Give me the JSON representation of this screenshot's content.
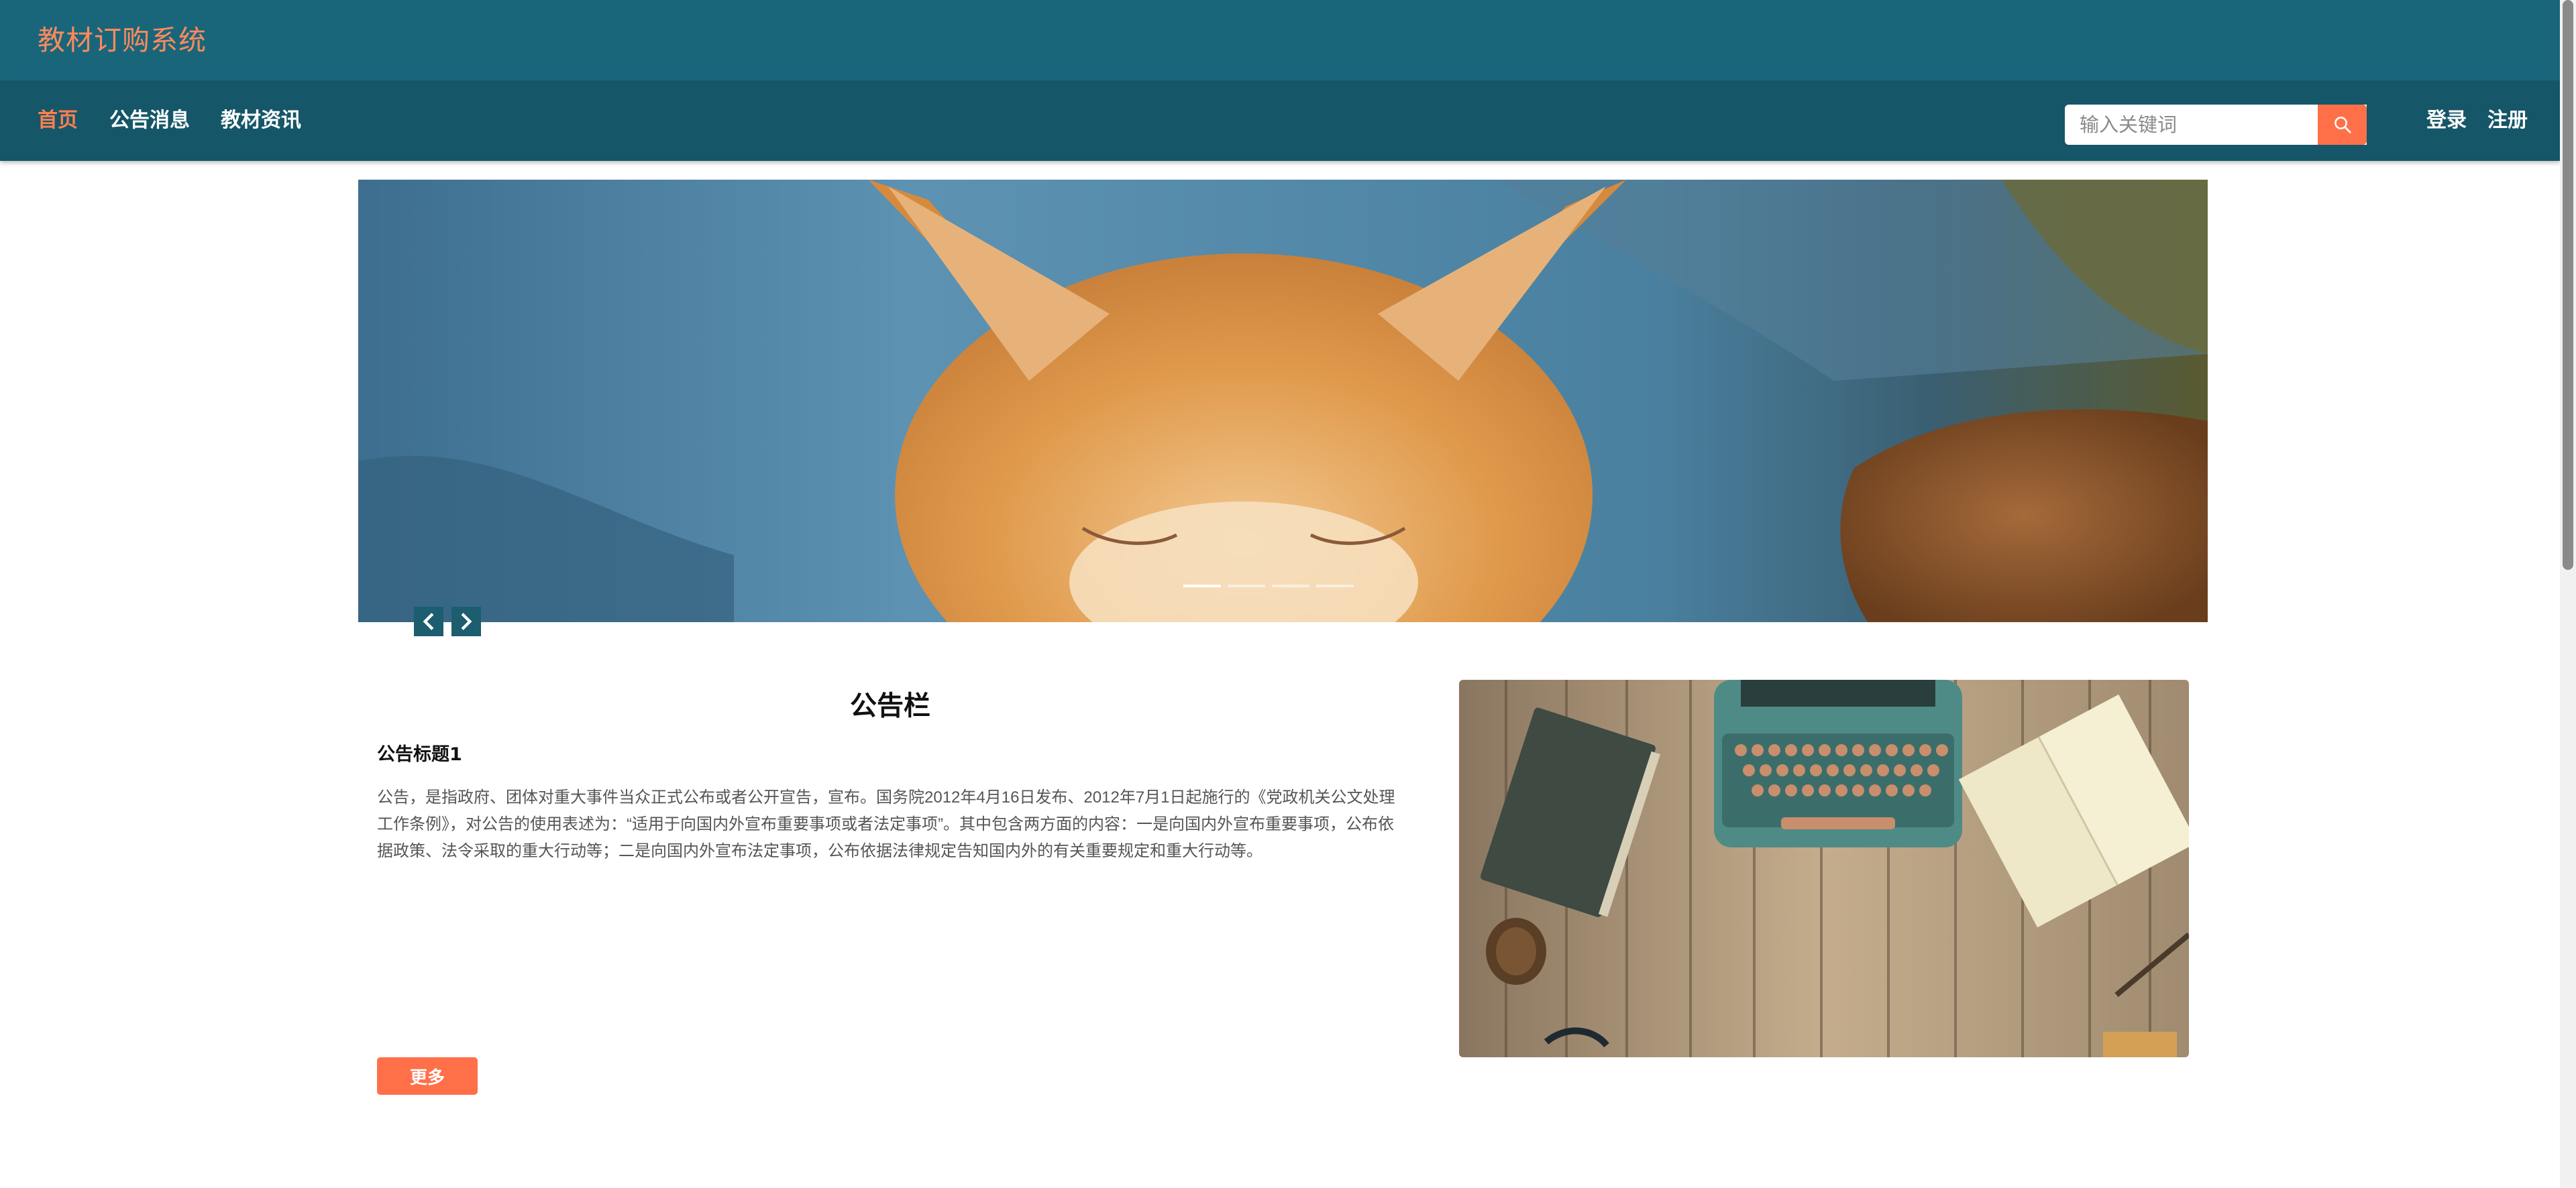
{
  "header": {
    "site_title": "教材订购系统"
  },
  "nav": {
    "items": [
      {
        "label": "首页",
        "active": true
      },
      {
        "label": "公告消息",
        "active": false
      },
      {
        "label": "教材资讯",
        "active": false
      }
    ],
    "search_placeholder": "输入关键词",
    "search_icon": "search-icon",
    "login_label": "登录",
    "register_label": "注册"
  },
  "banner": {
    "slide_count": 4,
    "active_slide": 1,
    "prev_icon": "chevron-left-icon",
    "next_icon": "chevron-right-icon"
  },
  "notice": {
    "heading": "公告栏",
    "title": "公告标题1",
    "body": "公告，是指政府、团体对重大事件当众正式公布或者公开宣告，宣布。国务院2012年4月16日发布、2012年7月1日起施行的《党政机关公文处理工作条例》，对公告的使用表述为：“适用于向国内外宣布重要事项或者法定事项”。其中包含两方面的内容：一是向国内外宣布重要事项，公布依据政策、法令采取的重大行动等；二是向国内外宣布法定事项，公布依据法律规定告知国内外的有关重要规定和重大行动等。",
    "more_label": "更多"
  },
  "colors": {
    "topbar": "#19667b",
    "navbar": "#155668",
    "accent": "#ff7049",
    "title_text": "#ff8a5c"
  }
}
